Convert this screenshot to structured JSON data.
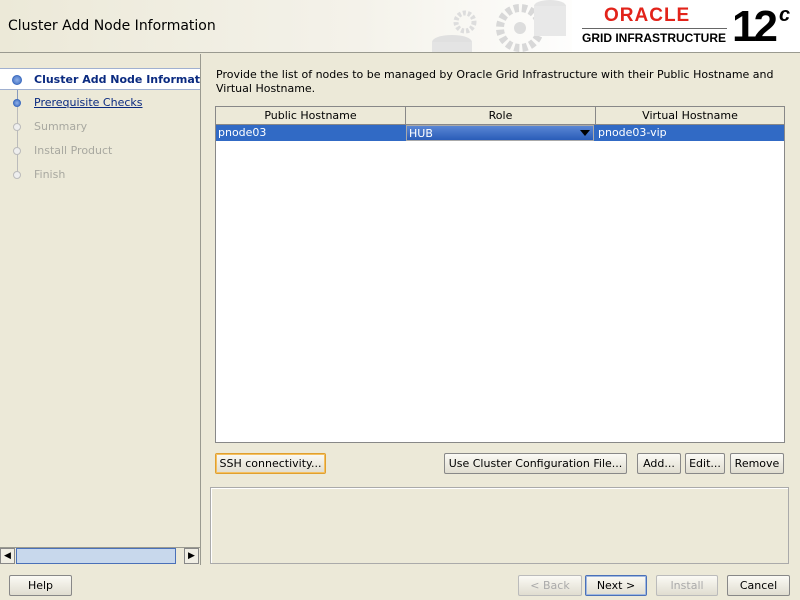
{
  "window": {
    "title": "Cluster Add Node Information"
  },
  "logo": {
    "brand": "ORACLE",
    "product": "GRID INFRASTRUCTURE",
    "version": "12",
    "version_suffix": "c",
    "brand_color": "#e2231a"
  },
  "sidebar": {
    "steps": [
      {
        "label": "Cluster Add Node Information",
        "state": "current"
      },
      {
        "label": "Prerequisite Checks",
        "state": "link"
      },
      {
        "label": "Summary",
        "state": "disabled"
      },
      {
        "label": "Install Product",
        "state": "disabled"
      },
      {
        "label": "Finish",
        "state": "disabled"
      }
    ]
  },
  "main": {
    "description": "Provide the list of nodes to be managed by Oracle Grid Infrastructure with their Public Hostname and Virtual Hostname.",
    "table": {
      "columns": [
        "Public Hostname",
        "Role",
        "Virtual Hostname"
      ],
      "rows": [
        {
          "public_hostname": "pnode03",
          "role": "HUB",
          "virtual_hostname": "pnode03-vip"
        }
      ]
    },
    "buttons": {
      "ssh": "SSH connectivity...",
      "config_file": "Use Cluster Configuration File...",
      "add": "Add...",
      "edit": "Edit...",
      "remove": "Remove"
    }
  },
  "footer": {
    "help": "Help",
    "back": "< Back",
    "next": "Next >",
    "install": "Install",
    "cancel": "Cancel"
  },
  "colors": {
    "selection": "#316ac5",
    "accent": "#0a2a80"
  }
}
